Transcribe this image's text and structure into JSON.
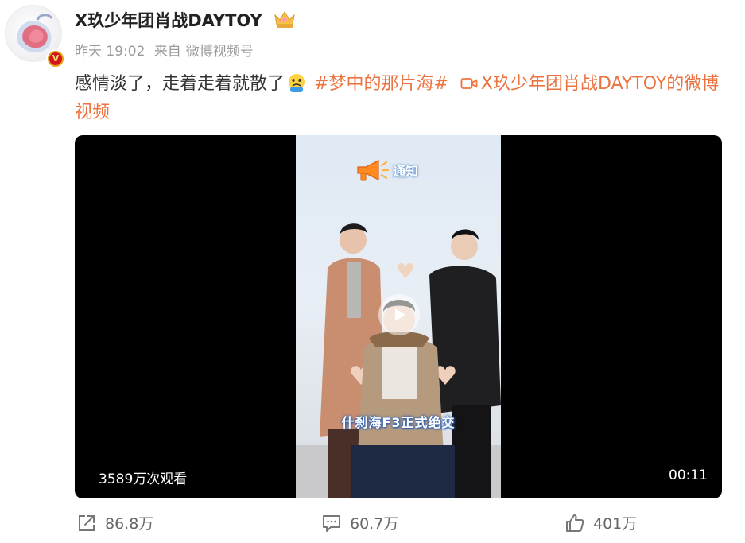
{
  "user": {
    "name": "X玖少年团肖战DAYTOY",
    "crown_icon": "crown-badge-icon",
    "verified_icon": "verified-v-icon"
  },
  "meta": {
    "time": "昨天 19:02",
    "source_prefix": "来自",
    "source": "微博视频号"
  },
  "post": {
    "text": "感情淡了，走着走着就散了",
    "emoji": "sad-face-emoji",
    "hashtag": "#梦中的那片海#",
    "video_link_text": "X玖少年团肖战DAYTOY的微博视频"
  },
  "video": {
    "notice_text": "通知",
    "caption": "什刹海F3正式绝交",
    "views": "3589万次观看",
    "duration": "00:11"
  },
  "actions": {
    "repost": "86.8万",
    "comment": "60.7万",
    "like": "401万"
  },
  "colors": {
    "link": "#eb7340",
    "meta": "#999999",
    "video_bg": "#000000"
  }
}
